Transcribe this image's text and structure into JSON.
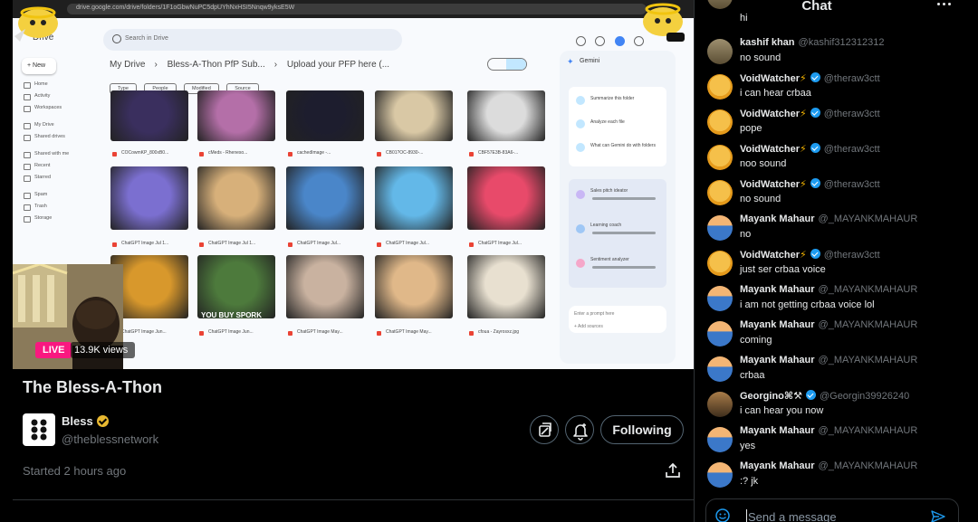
{
  "browser": {
    "url": "drive.google.com/drive/folders/1F1oGbwNuPC5dpUYhNxHSI5Nnqw9yksE5W"
  },
  "drive": {
    "logo_label": "Drive",
    "search_placeholder": "Search in Drive",
    "new_label": "New",
    "sidebar": [
      "Home",
      "Activity",
      "Workspaces",
      "My Drive",
      "Shared drives",
      "Shared with me",
      "Recent",
      "Starred",
      "Spam",
      "Trash",
      "Storage"
    ],
    "breadcrumb": [
      "My Drive",
      "Bless-A-Thon PfP Sub...",
      "Upload your PFP here (..."
    ],
    "filters": [
      "Type",
      "People",
      "Modified",
      "Source"
    ],
    "captions": [
      [
        "COCowmKP_800xB0...",
        "cMeds - Rheneso...",
        "cachedImage -...",
        "CB01?OC-8930-...",
        "CBF57E3B-83A6-..."
      ],
      [
        "ChatGPT Image Jul 1...",
        "ChatGPT Image Jul 1...",
        "ChatGPT Image Jul...",
        "ChatGPT Image Jul...",
        "ChatGPT Image Jul..."
      ],
      [
        "ChatGPT Image Jun...",
        "ChatGPT Image Jun...",
        "ChatGPT Image May...",
        "ChatGPT Image May...",
        "cfoua - Zayrosxz.jpg"
      ]
    ],
    "pepe_caption": "YOU BUY SPORK",
    "gemini": {
      "title": "Gemini",
      "suggestions": [
        "Summarize this folder",
        "Analyze each file",
        "What can Gemini do with folders"
      ],
      "gems": [
        "Sales pitch ideator",
        "Learning coach",
        "Sentiment analyzer"
      ],
      "prompt_placeholder": "Enter a prompt here",
      "add_sources": "+ Add sources"
    }
  },
  "stream": {
    "live_label": "LIVE",
    "views": "13.9K views",
    "title": "The Bless-A-Thon",
    "host_name": "Bless",
    "host_handle": "@theblessnetwork",
    "following_label": "Following",
    "started": "Started 2 hours ago"
  },
  "chat": {
    "title": "Chat",
    "partial_top_text": "hi",
    "messages": [
      {
        "name": "kashif khan",
        "handle": "@kashif312312312",
        "text": "no sound",
        "verified": false,
        "bolt": false,
        "avatar": "man"
      },
      {
        "name": "VoidWatcher",
        "handle": "@theraw3ctt",
        "text": "i can hear crbaa",
        "verified": true,
        "bolt": true,
        "avatar": "cat"
      },
      {
        "name": "VoidWatcher",
        "handle": "@theraw3ctt",
        "text": "pope",
        "verified": true,
        "bolt": true,
        "avatar": "cat"
      },
      {
        "name": "VoidWatcher",
        "handle": "@theraw3ctt",
        "text": "noo sound",
        "verified": true,
        "bolt": true,
        "avatar": "cat"
      },
      {
        "name": "VoidWatcher",
        "handle": "@theraw3ctt",
        "text": "no sound",
        "verified": true,
        "bolt": true,
        "avatar": "cat"
      },
      {
        "name": "Mayank Mahaur",
        "handle": "@_MAYANKMAHAUR",
        "text": "no",
        "verified": false,
        "bolt": false,
        "avatar": "boy"
      },
      {
        "name": "VoidWatcher",
        "handle": "@theraw3ctt",
        "text": "just ser crbaa voice",
        "verified": true,
        "bolt": true,
        "avatar": "cat"
      },
      {
        "name": "Mayank Mahaur",
        "handle": "@_MAYANKMAHAUR",
        "text": "i am not getting crbaa voice  lol",
        "verified": false,
        "bolt": false,
        "avatar": "boy"
      },
      {
        "name": "Mayank Mahaur",
        "handle": "@_MAYANKMAHAUR",
        "text": "coming",
        "verified": false,
        "bolt": false,
        "avatar": "boy"
      },
      {
        "name": "Mayank Mahaur",
        "handle": "@_MAYANKMAHAUR",
        "text": "crbaa",
        "verified": false,
        "bolt": false,
        "avatar": "boy"
      },
      {
        "name": "Georgino⌘⚒",
        "handle": "@Georgin39926240",
        "text": "i can hear you now",
        "verified": true,
        "bolt": false,
        "avatar": "geo"
      },
      {
        "name": "Mayank Mahaur",
        "handle": "@_MAYANKMAHAUR",
        "text": "yes",
        "verified": false,
        "bolt": false,
        "avatar": "boy"
      },
      {
        "name": "Mayank Mahaur",
        "handle": "@_MAYANKMAHAUR",
        "text": ":? jk",
        "verified": false,
        "bolt": false,
        "avatar": "boy"
      }
    ],
    "input_placeholder": "Send a message"
  },
  "icons": [
    "search-icon",
    "more-icon",
    "share-icon",
    "emoji-icon",
    "send-icon",
    "verified-icon",
    "clip-icon",
    "reminder-icon"
  ],
  "colors": {
    "live": "#f91880",
    "verified": "#1d9bf0",
    "gold_badge": "#e8b830",
    "muted": "#71767b"
  }
}
